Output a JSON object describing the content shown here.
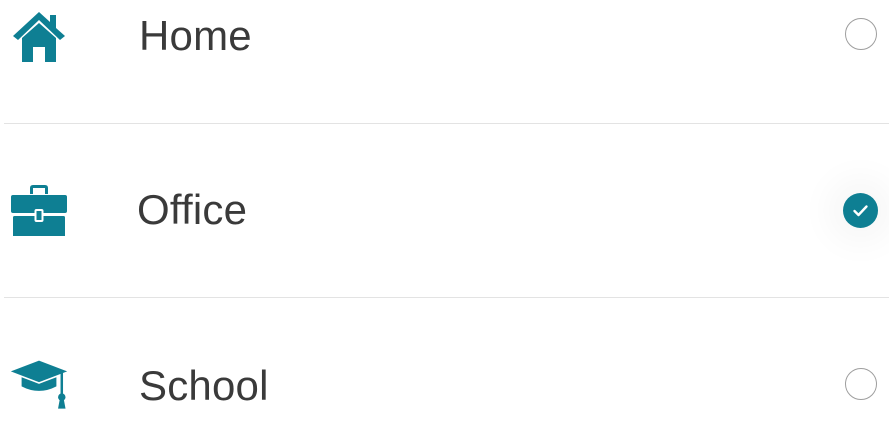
{
  "colors": {
    "accent": "#0e7f93",
    "label_text": "#3a3a3a",
    "radio_border": "#9e9e9e",
    "divider": "#e3e3e3"
  },
  "options": [
    {
      "label": "Home",
      "icon": "home-icon",
      "selected": false
    },
    {
      "label": "Office",
      "icon": "briefcase-icon",
      "selected": true
    },
    {
      "label": "School",
      "icon": "graduation-cap-icon",
      "selected": false
    }
  ]
}
